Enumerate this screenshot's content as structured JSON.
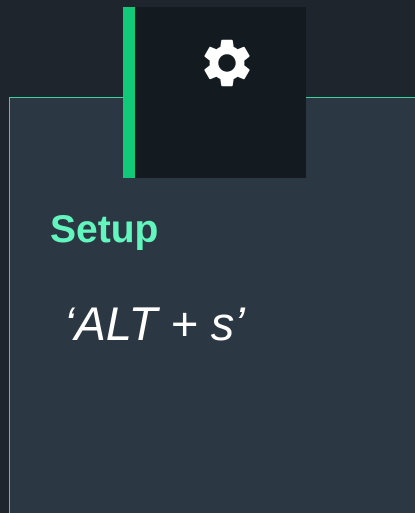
{
  "tooltip": {
    "title": "Setup",
    "shortcut": "‘ALT + s’",
    "icon": "gear-icon"
  },
  "colors": {
    "background": "#1f252c",
    "panel": "#2b3742",
    "tab": "#131a20",
    "accent": "#12c97a",
    "title": "#63f5be",
    "text": "#ffffff"
  }
}
